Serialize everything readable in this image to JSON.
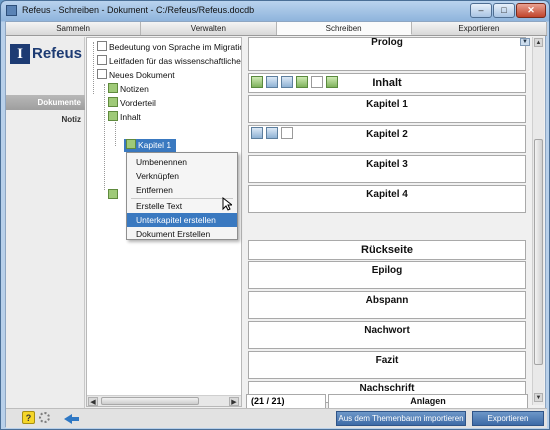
{
  "window": {
    "title": "Refeus - Schreiben - Dokument - C:/Refeus/Refeus.docdb",
    "minimize": "–",
    "maximize": "□",
    "close": "✕"
  },
  "tabs": [
    "Sammeln",
    "Verwalten",
    "Schreiben",
    "Exportieren"
  ],
  "active_tab": "Schreiben",
  "logo": {
    "mark": "I",
    "text": "Refeus"
  },
  "left_nav": [
    {
      "label": "Dokumente",
      "active": true
    },
    {
      "label": "Notiz",
      "active": false
    }
  ],
  "tree": {
    "items": [
      {
        "label": "Bedeutung von Sprache im Migratio",
        "icon": "document-icon"
      },
      {
        "label": "Leitfaden für das wissenschaftliche",
        "icon": "document-icon"
      },
      {
        "label": "Neues Dokument",
        "icon": "document-icon"
      },
      {
        "label": "Notizen",
        "icon": "note-icon"
      },
      {
        "label": "Vorderteil",
        "icon": "folder-icon"
      },
      {
        "label": "Inhalt",
        "icon": "folder-icon"
      },
      {
        "label": "Kapitel 1",
        "icon": "chapter-icon",
        "selected": true
      }
    ]
  },
  "context_menu": {
    "items": [
      "Umbenennen",
      "Verknüpfen",
      "Entfernen",
      "Erstelle Text",
      "Unterkapitel erstellen",
      "Dokument Erstellen"
    ],
    "hover": "Unterkapitel erstellen"
  },
  "editor": {
    "prolog": "Prolog",
    "content_title": "Inhalt",
    "chapters": [
      "Kapitel 1",
      "Kapitel 2",
      "Kapitel 3",
      "Kapitel 4"
    ],
    "back_title": "Rückseite",
    "back_items": [
      "Epilog",
      "Abspann",
      "Nachwort",
      "Fazit",
      "Nachschrift",
      "Anlagen"
    ],
    "counter": "(21 / 21)"
  },
  "bottom": {
    "help": "?",
    "import_button": "Aus dem Themenbaum importieren",
    "export_button": "Exportieren"
  }
}
